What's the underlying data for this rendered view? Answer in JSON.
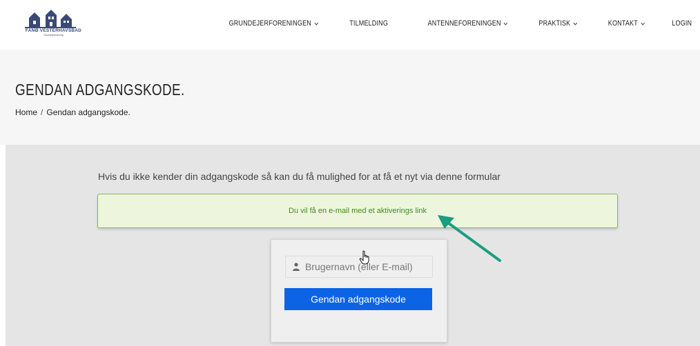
{
  "logo": {
    "brand": "FANØ VESTERHAVSBAD",
    "tagline": "Grundejerforening",
    "color": "#3a4a78"
  },
  "nav": {
    "items": [
      {
        "label": "GRUNDEJERFORENINGEN",
        "has_dropdown": true
      },
      {
        "label": "TILMELDING",
        "has_dropdown": false
      },
      {
        "label": "ANTENNEFORENINGEN",
        "has_dropdown": true
      },
      {
        "label": "PRAKTISK",
        "has_dropdown": true
      },
      {
        "label": "KONTAKT",
        "has_dropdown": true
      },
      {
        "label": "LOGIN",
        "has_dropdown": false
      }
    ]
  },
  "title_band": {
    "title": "GENDAN ADGANGSKODE.",
    "breadcrumb": {
      "home": "Home",
      "separator": "/",
      "current": "Gendan adgangskode."
    }
  },
  "form": {
    "intro": "Hvis du ikke kender din adgangskode så kan du få mulighed for at få et nyt via denne formular",
    "alert": "Du vil få en e-mail med et aktiverings link",
    "username_placeholder": "Brugernavn (eller E-mail)",
    "submit_label": "Gendan adgangskode"
  },
  "colors": {
    "alert_bg": "#eef5dd",
    "alert_border": "#8bb55b",
    "alert_text": "#3e8d1e",
    "button_bg": "#0b63e5",
    "annotation_arrow": "#1a9e80"
  },
  "icons": [
    "logo-houses-icon",
    "chevron-down-icon",
    "user-icon",
    "hand-cursor-icon",
    "annotation-arrow-icon"
  ]
}
